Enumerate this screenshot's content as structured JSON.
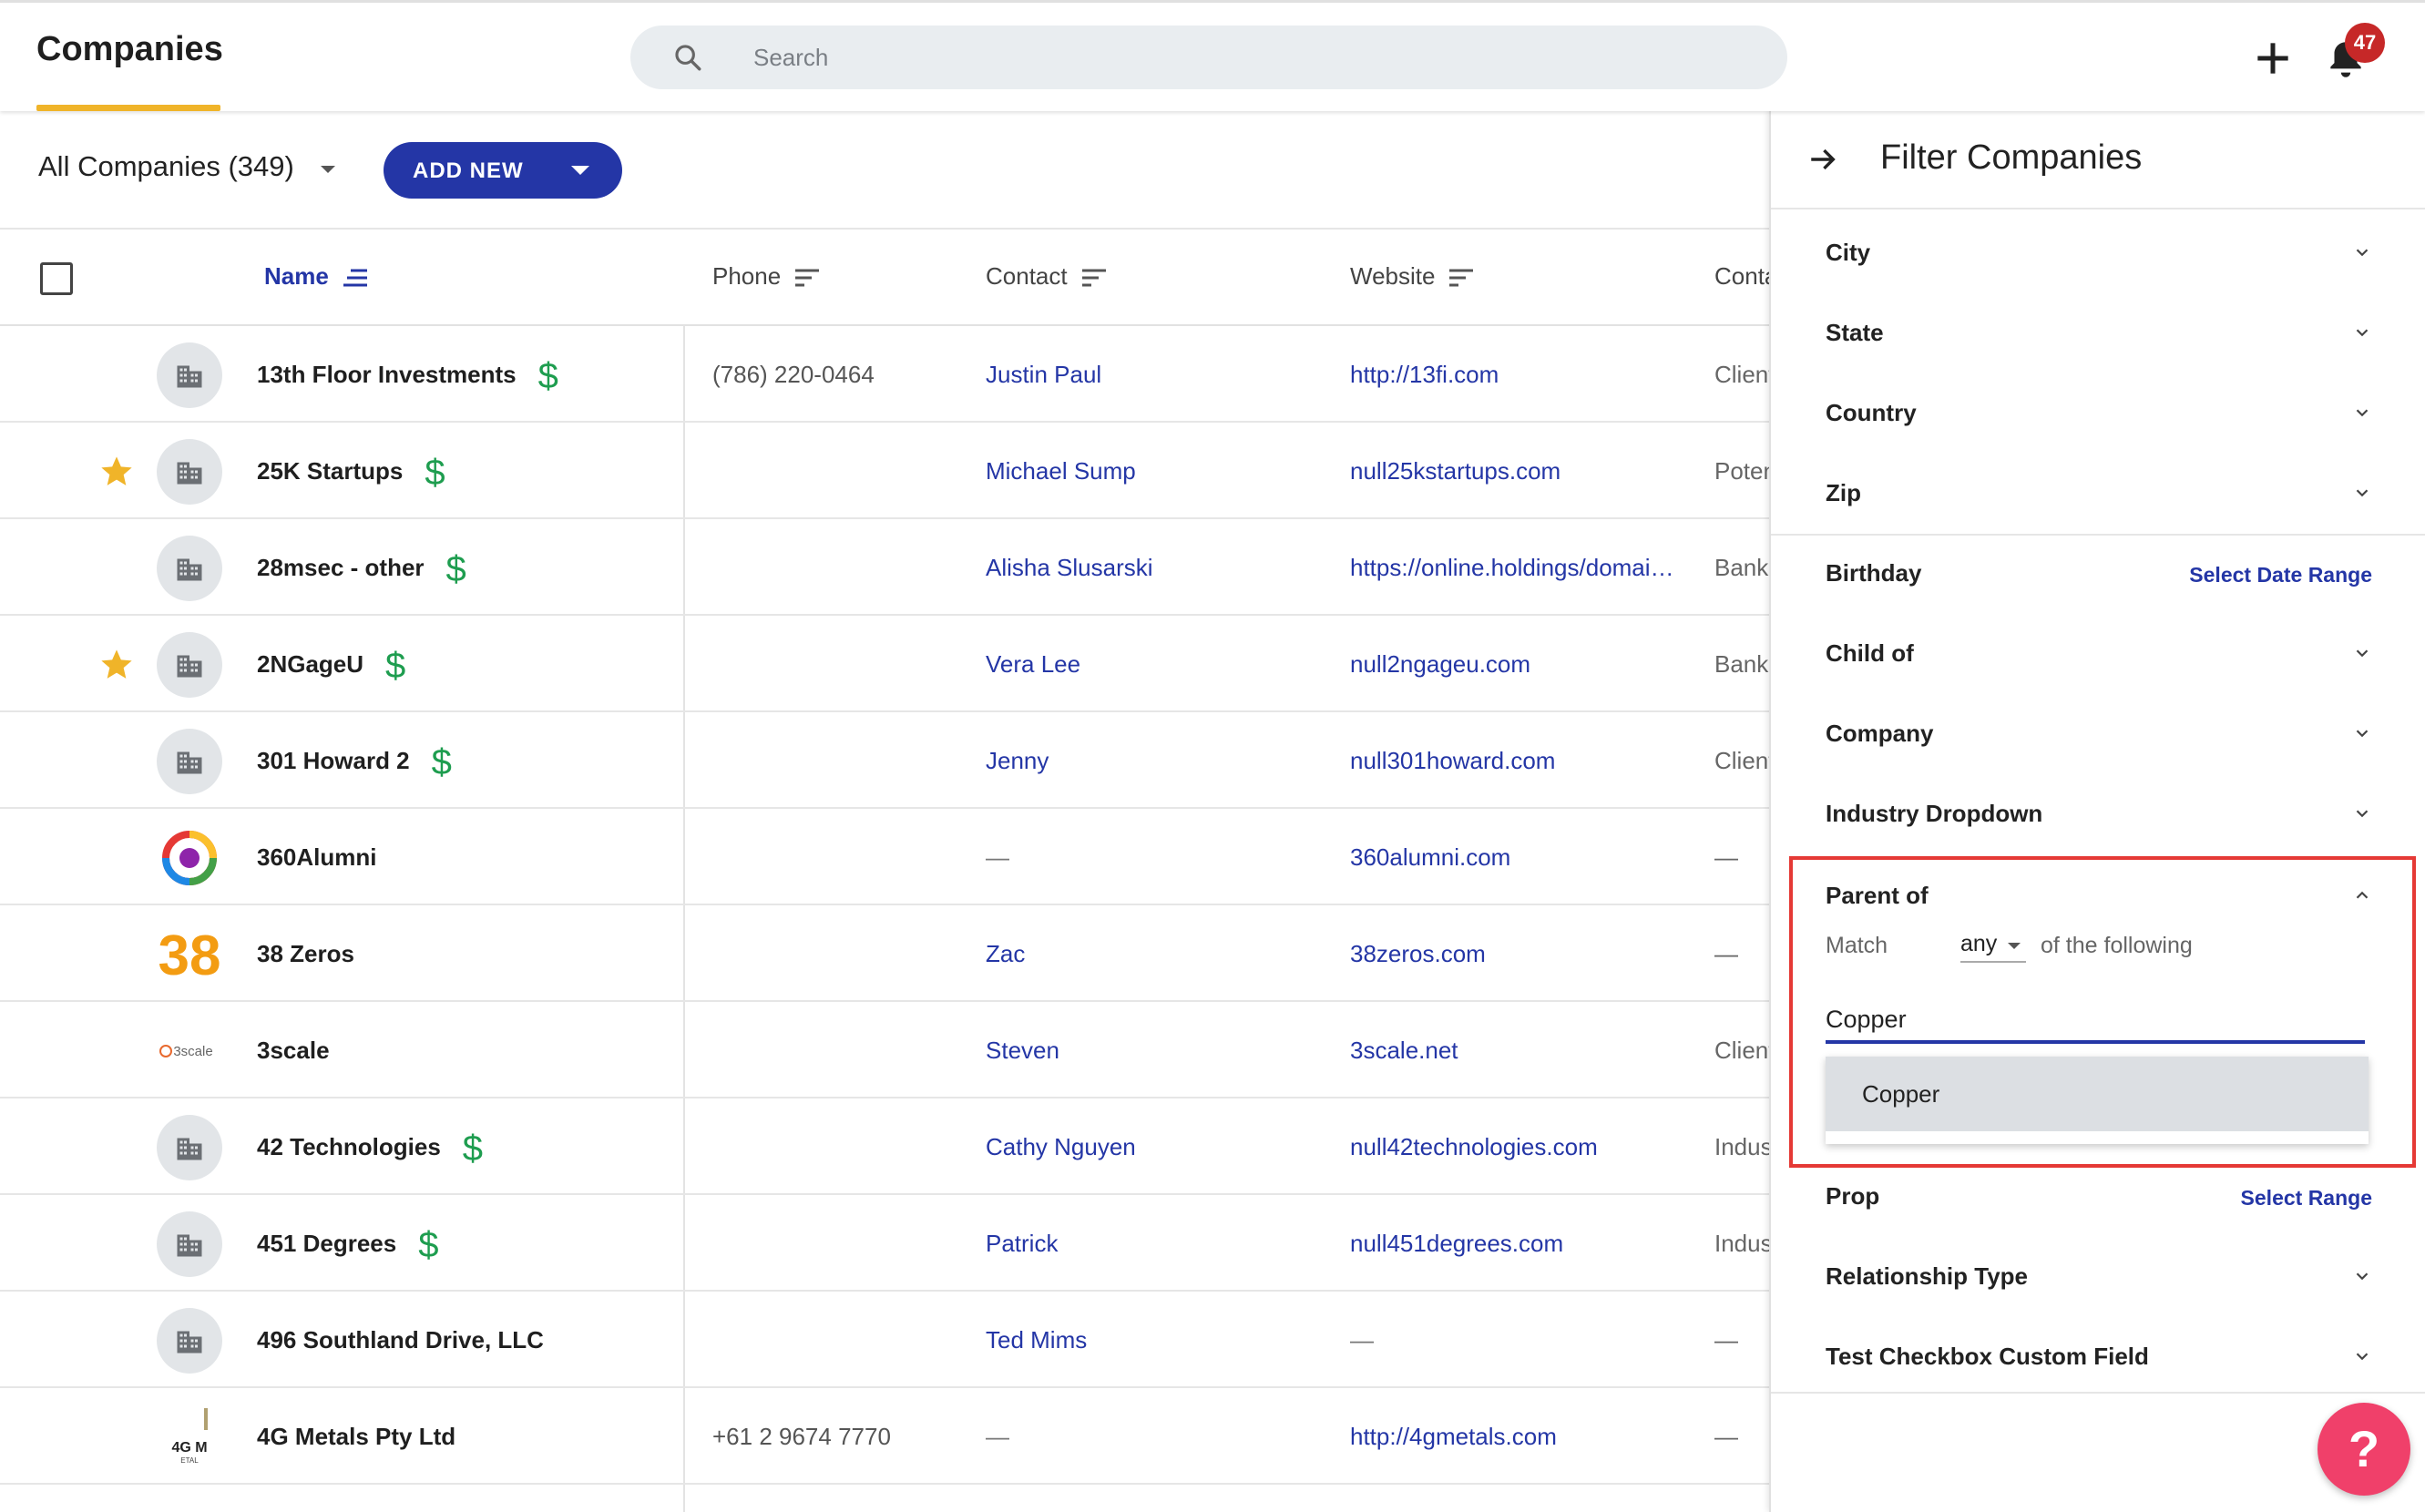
{
  "header": {
    "title": "Companies",
    "search_placeholder": "Search",
    "notification_count": "47"
  },
  "toolbar": {
    "view_label": "All Companies (349)",
    "add_new_label": "ADD NEW"
  },
  "table": {
    "columns": [
      "Name",
      "Phone",
      "Contact",
      "Website",
      "Conta"
    ],
    "rows": [
      {
        "name": "13th Floor Investments",
        "dollar": true,
        "star": false,
        "avatar": "building",
        "phone": "(786) 220-0464",
        "contact": "Justin Paul",
        "website": "http://13fi.com",
        "ctype": "Client"
      },
      {
        "name": "25K Startups",
        "dollar": true,
        "star": true,
        "avatar": "building",
        "phone": "",
        "contact": "Michael Sump",
        "website": "null25kstartups.com",
        "ctype": "Poten"
      },
      {
        "name": "28msec - other",
        "dollar": true,
        "star": false,
        "avatar": "building",
        "phone": "",
        "contact": "Alisha Slusarski",
        "website": "https://online.holdings/domai…",
        "ctype": "Bank"
      },
      {
        "name": "2NGageU",
        "dollar": true,
        "star": true,
        "avatar": "building",
        "phone": "",
        "contact": "Vera Lee",
        "website": "null2ngageu.com",
        "ctype": "Bank"
      },
      {
        "name": "301 Howard 2",
        "dollar": true,
        "star": false,
        "avatar": "building",
        "phone": "",
        "contact": "Jenny",
        "website": "null301howard.com",
        "ctype": "Client"
      },
      {
        "name": "360Alumni",
        "dollar": false,
        "star": false,
        "avatar": "logo-360",
        "phone": "",
        "contact": "—",
        "website": "360alumni.com",
        "ctype": "—"
      },
      {
        "name": "38 Zeros",
        "dollar": false,
        "star": false,
        "avatar": "logo-38",
        "phone": "",
        "contact": "Zac",
        "website": "38zeros.com",
        "ctype": "—"
      },
      {
        "name": "3scale",
        "dollar": false,
        "star": false,
        "avatar": "logo-3scale",
        "phone": "",
        "contact": "Steven",
        "website": "3scale.net",
        "ctype": "Client"
      },
      {
        "name": "42 Technologies",
        "dollar": true,
        "star": false,
        "avatar": "building",
        "phone": "",
        "contact": "Cathy Nguyen",
        "website": "null42technologies.com",
        "ctype": "Indus"
      },
      {
        "name": "451 Degrees",
        "dollar": true,
        "star": false,
        "avatar": "building",
        "phone": "",
        "contact": "Patrick",
        "website": "null451degrees.com",
        "ctype": "Indus"
      },
      {
        "name": "496 Southland Drive, LLC",
        "dollar": false,
        "star": false,
        "avatar": "building",
        "phone": "",
        "contact": "Ted Mims",
        "website": "—",
        "ctype": "—"
      },
      {
        "name": "4G Metals Pty Ltd",
        "dollar": false,
        "star": false,
        "avatar": "logo-4g",
        "phone": "+61 2 9674 7770",
        "contact": "—",
        "website": "http://4gmetals.com",
        "ctype": "—"
      }
    ]
  },
  "filter_panel": {
    "title": "Filter Companies",
    "filters": [
      {
        "label": "City",
        "control": "chevron"
      },
      {
        "label": "State",
        "control": "chevron"
      },
      {
        "label": "Country",
        "control": "chevron"
      },
      {
        "label": "Zip",
        "control": "chevron"
      },
      {
        "label": "Birthday",
        "control": "link",
        "link_label": "Select Date Range"
      },
      {
        "label": "Child of",
        "control": "chevron"
      },
      {
        "label": "Company",
        "control": "chevron"
      },
      {
        "label": "Industry Dropdown",
        "control": "chevron"
      }
    ],
    "parent_of": {
      "label": "Parent of",
      "match_prefix": "Match",
      "match_value": "any",
      "match_suffix": "of the following",
      "input_value": "Copper",
      "suggestions": [
        "Copper"
      ]
    },
    "filters_after": [
      {
        "label": "Prop",
        "control": "link",
        "link_label": "Select Range"
      },
      {
        "label": "Relationship Type",
        "control": "chevron"
      },
      {
        "label": "Test Checkbox Custom Field",
        "control": "chevron"
      }
    ]
  },
  "help": {
    "label": "?"
  },
  "colors": {
    "accent": "#2436a6",
    "underline": "#f0b429",
    "badge": "#c62828",
    "dollar": "#1e9d4f",
    "star": "#f0b429",
    "highlight": "#e53935",
    "help": "#f0406a"
  }
}
